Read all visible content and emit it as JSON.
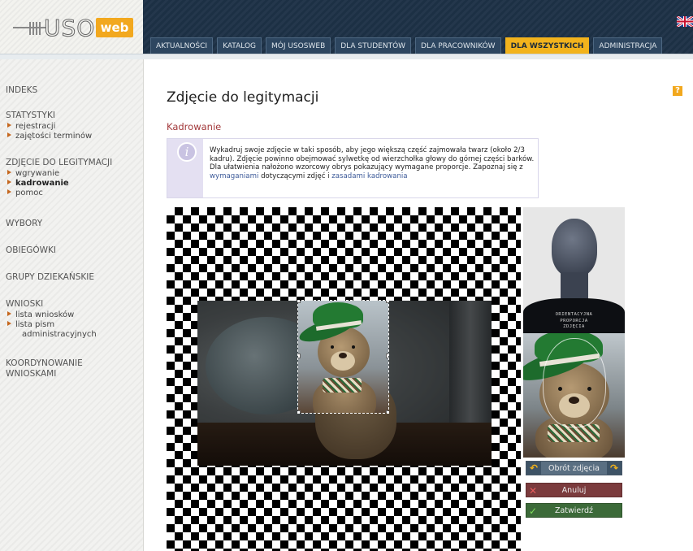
{
  "header": {
    "logo_text": "USOS",
    "logo_badge": "web",
    "tabs": [
      {
        "label": "AKTUALNOŚCI"
      },
      {
        "label": "KATALOG"
      },
      {
        "label": "MÓJ USOSWEB"
      },
      {
        "label": "DLA STUDENTÓW"
      },
      {
        "label": "DLA PRACOWNIKÓW"
      },
      {
        "label": "DLA WSZYSTKICH",
        "active": true
      },
      {
        "label": "ADMINISTRACJA"
      }
    ],
    "language_icon": "uk-flag-icon"
  },
  "sidebar": {
    "indeks": "INDEKS",
    "statystyki": "STATYSTYKI",
    "statystyki_items": [
      "rejestracji",
      "zajętości terminów"
    ],
    "zdjecie": "ZDJĘCIE DO LEGITYMACJI",
    "zdjecie_items": [
      "wgrywanie",
      "kadrowanie",
      "pomoc"
    ],
    "wybory": "WYBORY",
    "obiegowki": "OBIEGÓWKI",
    "grupy": "GRUPY DZIEKAŃSKIE",
    "wnioski": "WNIOSKI",
    "wnioski_items": [
      "lista wniosków",
      "lista pism",
      "administracyjnych"
    ],
    "koordynowanie": "KOORDYNOWANIE",
    "koordynowanie2": "WNIOSKAMI"
  },
  "main": {
    "title": "Zdjęcie do legitymacji",
    "subtitle": "Kadrowanie",
    "help": "?",
    "info_icon": "i",
    "info_text_1": "Wykadruj swoje zdjęcie w taki sposób, aby jego większą część zajmowała twarz (około 2/3 kadru). Zdjęcie powinno obejmować sylwetkę od wierzchołka głowy do górnej części barków. Dla ułatwienia nałożono wzorcowy obrys pokazujący wymagane proporcje. Zapoznaj się z ",
    "info_link_1": "wymaganiami",
    "info_text_2": " dotyczącymi zdjęć i ",
    "info_link_2": "zasadami kadrowania"
  },
  "panel": {
    "silhouette_line1": "ORIENTACYJNA",
    "silhouette_line2": "PROPORCJA",
    "silhouette_line3": "ZDJĘCIA",
    "rotate_label": "Obrót zdjęcia",
    "cancel_label": "Anuluj",
    "confirm_label": "Zatwierdź"
  },
  "colors": {
    "header_bg": "#1d3146",
    "accent": "#f2b31c",
    "section_title": "#a2383a",
    "cancel_bg": "#7b3b3d",
    "confirm_bg": "#3c6a39",
    "rotate_bg": "#5a6f82"
  }
}
